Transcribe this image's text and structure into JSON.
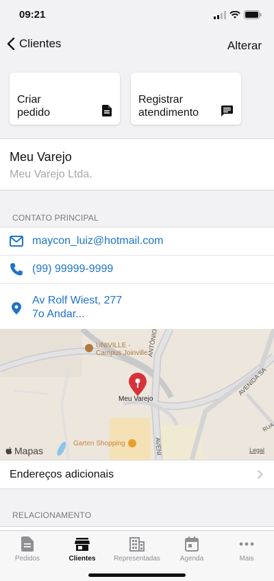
{
  "status_bar": {
    "time": "09:21"
  },
  "nav": {
    "back_label": "Clientes",
    "edit_label": "Alterar"
  },
  "actions": [
    {
      "label_line1": "Criar",
      "label_line2": "pedido",
      "icon": "document-icon"
    },
    {
      "label_line1": "Registrar",
      "label_line2": "atendimento",
      "icon": "message-icon"
    }
  ],
  "client": {
    "name": "Meu Varejo",
    "company": "Meu Varejo Ltda."
  },
  "contact_section": {
    "header": "CONTATO PRINCIPAL",
    "email": "maycon_luiz@hotmail.com",
    "phone": "(99) 99999-9999",
    "address_line1": "Av Rolf Wiest, 277",
    "address_line2": "7o Andar..."
  },
  "map": {
    "poi_univille_line1": "UNIVILLE -",
    "poi_univille_line2": "Campus Joinville",
    "street_1": "ANTÔNIO JOÃO",
    "street_2": "AVENIDA SA",
    "street_3": "AVENI",
    "street_4": "RUA",
    "pin_label": "Meu Varejo",
    "poi_shopping": "Garten Shopping",
    "maps_brand": "Mapas",
    "legal": "Legal"
  },
  "additional_addresses": {
    "label": "Endereços adicionais"
  },
  "relationship_section": {
    "header": "RELACIONAMENTO"
  },
  "tabs": [
    {
      "label": "Pedidos",
      "icon": "document-icon",
      "active": false
    },
    {
      "label": "Clientes",
      "icon": "store-icon",
      "active": true
    },
    {
      "label": "Representadas",
      "icon": "building-icon",
      "active": false
    },
    {
      "label": "Agenda",
      "icon": "calendar-icon",
      "active": false
    },
    {
      "label": "Mais",
      "icon": "more-icon",
      "active": false
    }
  ],
  "colors": {
    "link": "#1d73c9",
    "pin": "#d8313b",
    "background": "#f2f2f4"
  }
}
